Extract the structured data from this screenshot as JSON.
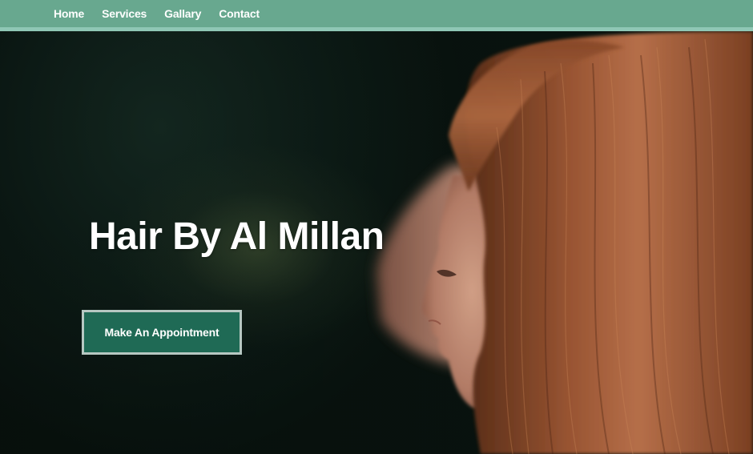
{
  "nav": {
    "items": [
      {
        "label": "Home"
      },
      {
        "label": "Services"
      },
      {
        "label": "Gallary"
      },
      {
        "label": "Contact"
      }
    ]
  },
  "hero": {
    "title": "Hair By Al Millan",
    "cta_label": "Make An Appointment"
  },
  "colors": {
    "navbar": "#68a88f",
    "navbar_border": "#8fc7b5",
    "cta_background": "#1f6a55",
    "cta_border": "#b7c8c2"
  }
}
